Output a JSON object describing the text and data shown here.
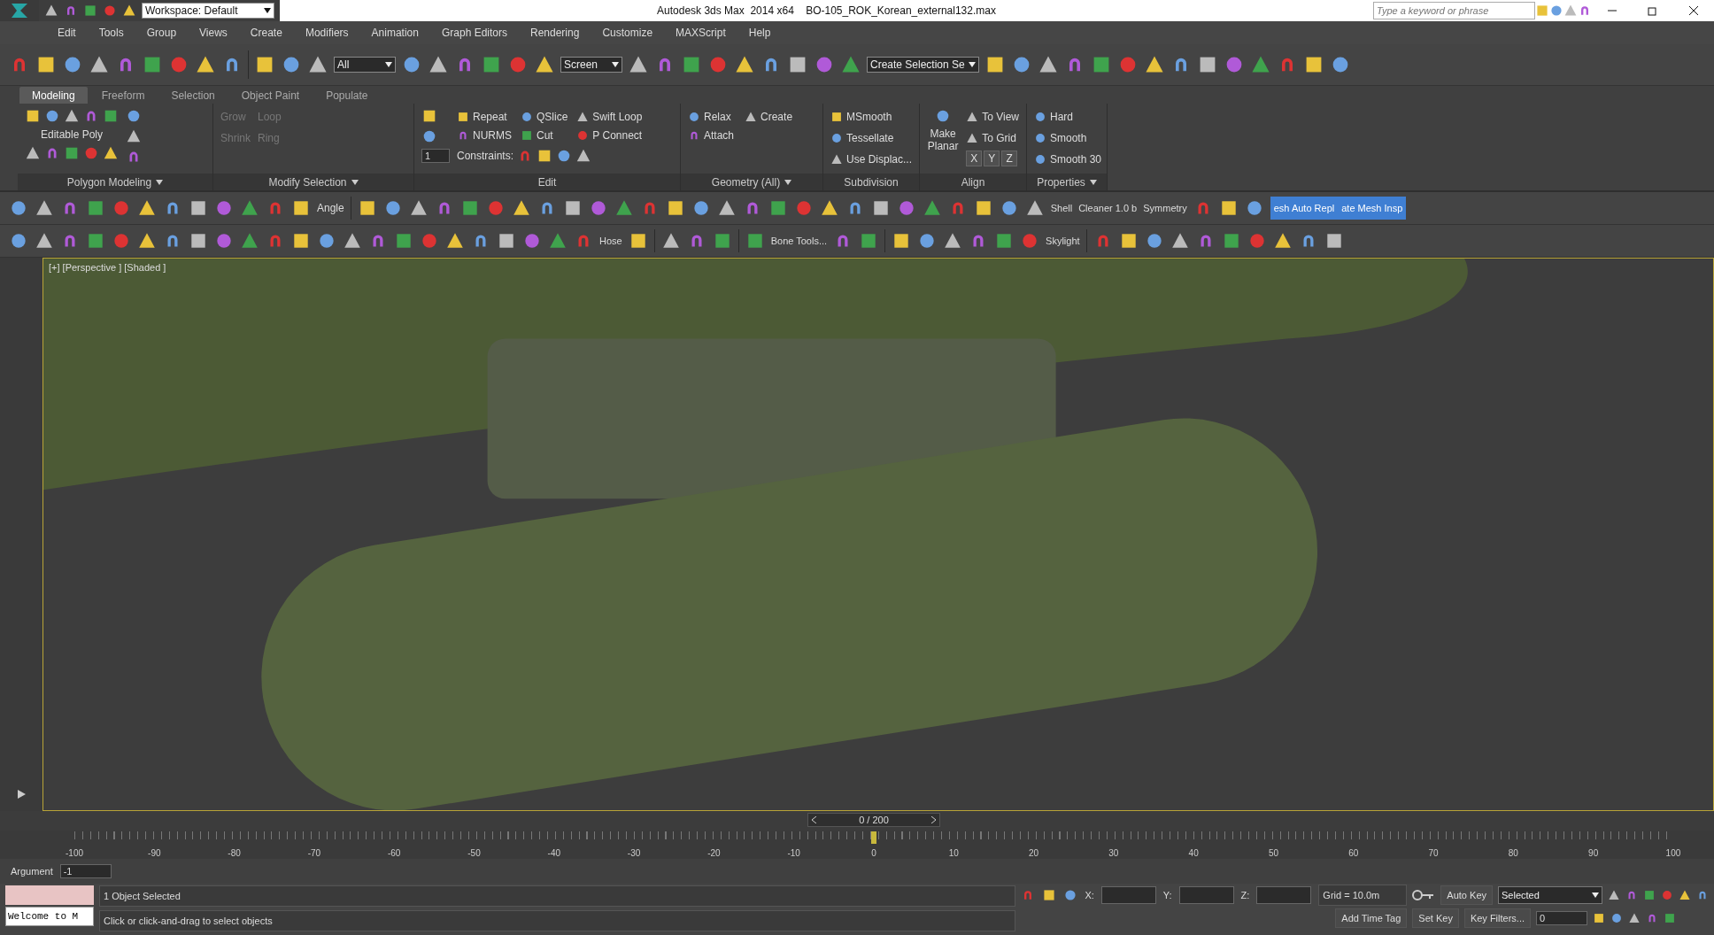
{
  "title_bar": {
    "workspace": "Workspace: Default",
    "app": "Autodesk 3ds Max  2014 x64",
    "file": "BO-105_ROK_Korean_external132.max",
    "search": {
      "placeholder": "Type a keyword or phrase"
    }
  },
  "menu": [
    "Edit",
    "Tools",
    "Group",
    "Views",
    "Create",
    "Modifiers",
    "Animation",
    "Graph Editors",
    "Rendering",
    "Customize",
    "MAXScript",
    "Help"
  ],
  "main_toolbar": {
    "selection_filter": "All",
    "reference_coord": "Screen",
    "named_selection": "Create Selection Se"
  },
  "ribbon": {
    "tabs": [
      {
        "label": "Modeling",
        "selected": true
      },
      {
        "label": "Freeform",
        "selected": false
      },
      {
        "label": "Selection",
        "selected": false
      },
      {
        "label": "Object Paint",
        "selected": false
      },
      {
        "label": "Populate",
        "selected": false
      }
    ],
    "polygon_modeling": {
      "label": "Editable Poly",
      "title": "Polygon Modeling"
    },
    "modify_selection": {
      "title": "Modify Selection",
      "items": [
        {
          "label": "Grow",
          "disabled": true
        },
        {
          "label": "Shrink",
          "disabled": true
        },
        {
          "label": "Loop",
          "disabled": true
        },
        {
          "label": "Ring",
          "disabled": true
        }
      ]
    },
    "edit": {
      "title": "Edit",
      "spinner": "1",
      "items": [
        "Repeat",
        "QSlice",
        "Swift Loop",
        "NURMS",
        "Cut",
        "P Connect"
      ],
      "constraints": "Constraints:"
    },
    "geometry": {
      "title": "Geometry (All)",
      "items": [
        "Relax",
        "Create",
        "Attach"
      ]
    },
    "subdivision": {
      "title": "Subdivision",
      "items": [
        "MSmooth",
        "Tessellate",
        "Use Displac..."
      ]
    },
    "align": {
      "title": "Align",
      "make_planar": "Make Planar",
      "items": [
        "To View",
        "To Grid"
      ],
      "axes": [
        "X",
        "Y",
        "Z"
      ]
    },
    "properties": {
      "title": "Properties",
      "items": [
        "Hard",
        "Smooth",
        "Smooth 30"
      ]
    }
  },
  "toolbar_1": {
    "angle": "Angle",
    "labels": [
      "Shell",
      "Cleaner 1.0 b",
      "Symmetry"
    ],
    "blue_buttons": [
      "esh Auto Repl",
      "ate Mesh Insp"
    ]
  },
  "toolbar_2": {
    "hose": "Hose",
    "bone_tools": "Bone Tools...",
    "skylight": "Skylight"
  },
  "viewport": {
    "label": "[+] [Perspective ] [Shaded ]"
  },
  "timeline": {
    "frame": "0 / 200",
    "level": 0.5,
    "ticks": [
      "-100",
      "-90",
      "-80",
      "-70",
      "-60",
      "-50",
      "-40",
      "-30",
      "-20",
      "-10",
      "0",
      "10",
      "20",
      "30",
      "40",
      "50",
      "60",
      "70",
      "80",
      "90",
      "100"
    ]
  },
  "argument": {
    "label": "Argument",
    "value": "-1"
  },
  "status": {
    "listener": "Welcome to M",
    "selection": "1 Object Selected",
    "prompt": "Click or click-and-drag to select objects",
    "coords": [
      "X:",
      "Y:",
      "Z:"
    ],
    "grid": "Grid = 10.0m",
    "add_time_tag": "Add Time Tag",
    "auto_key": "Auto Key",
    "set_key": "Set Key",
    "key_mode": "Selected",
    "key_filters": "Key Filters...",
    "frame": "0"
  }
}
